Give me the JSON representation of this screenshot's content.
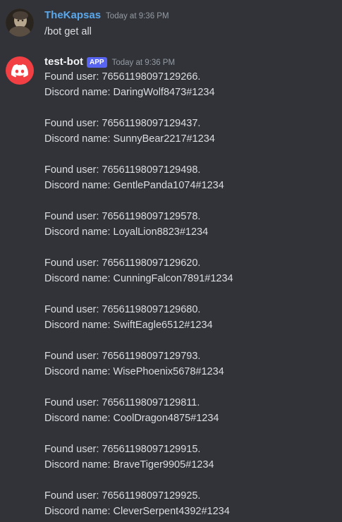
{
  "messages": [
    {
      "username": "TheKapsas",
      "timestamp": "Today at 9:36 PM",
      "text": "/bot get all"
    },
    {
      "username": "test-bot",
      "badge": "APP",
      "timestamp": "Today at 9:36 PM",
      "entries": [
        {
          "found": "Found user: 76561198097129266.",
          "discord": "Discord name: DaringWolf8473#1234"
        },
        {
          "found": "Found user: 76561198097129437.",
          "discord": "Discord name: SunnyBear2217#1234"
        },
        {
          "found": "Found user: 76561198097129498.",
          "discord": "Discord name: GentlePanda1074#1234"
        },
        {
          "found": "Found user: 76561198097129578.",
          "discord": "Discord name: LoyalLion8823#1234"
        },
        {
          "found": "Found user: 76561198097129620.",
          "discord": "Discord name: CunningFalcon7891#1234"
        },
        {
          "found": "Found user: 76561198097129680.",
          "discord": "Discord name: SwiftEagle6512#1234"
        },
        {
          "found": "Found user: 76561198097129793.",
          "discord": "Discord name: WisePhoenix5678#1234"
        },
        {
          "found": "Found user: 76561198097129811.",
          "discord": "Discord name: CoolDragon4875#1234"
        },
        {
          "found": "Found user: 76561198097129915.",
          "discord": "Discord name: BraveTiger9905#1234"
        },
        {
          "found": "Found user: 76561198097129925.",
          "discord": "Discord name: CleverSerpent4392#1234"
        }
      ]
    }
  ],
  "colors": {
    "background": "#313338",
    "user_name": "#5aa8ec",
    "bot_name": "#f2f3f5",
    "app_badge": "#5865f2",
    "bot_avatar": "#f23f43",
    "timestamp": "#949ba4",
    "text": "#dbdee1"
  },
  "icons": {
    "user_avatar": "profile-photo",
    "bot_avatar": "discord-logo-icon"
  }
}
